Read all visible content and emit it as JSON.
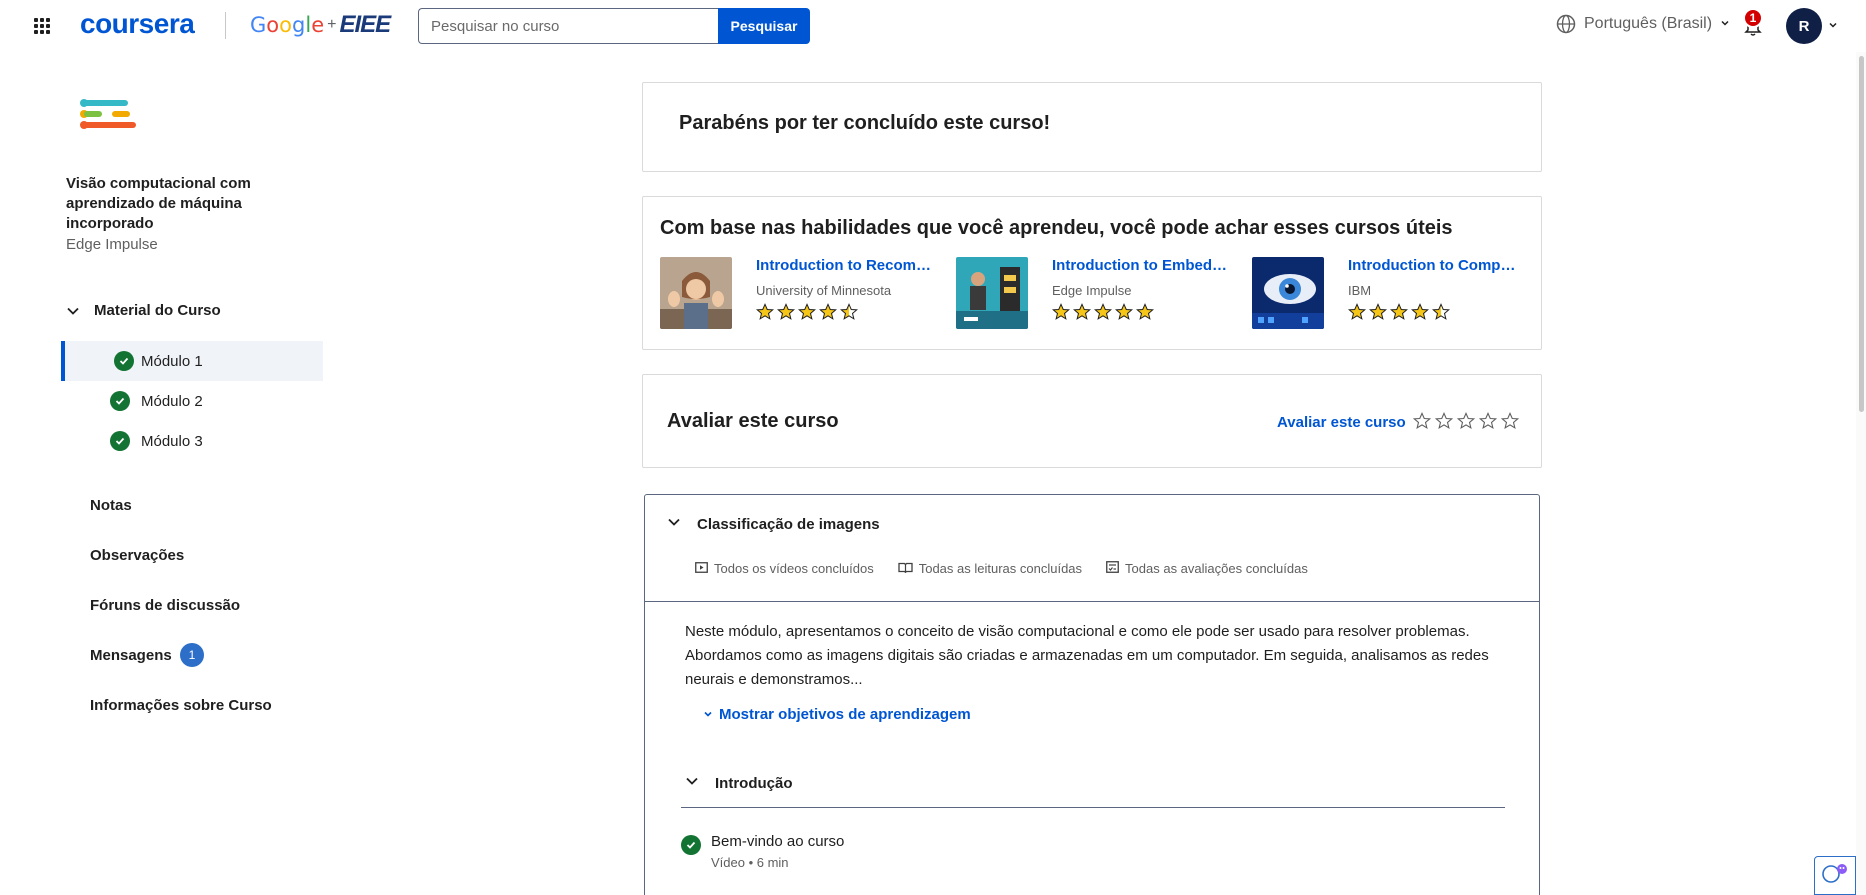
{
  "header": {
    "brand": "coursera",
    "partner_logo": {
      "google": "Google",
      "plus": "+",
      "eiee": "EIEE"
    },
    "search": {
      "placeholder": "Pesquisar no curso",
      "value": "",
      "button_label": "Pesquisar"
    },
    "language": "Português (Brasil)",
    "notifications_count": "1",
    "avatar_initial": "R",
    "icons": [
      "apps-grid-icon",
      "globe-icon",
      "chevron-down-icon",
      "bell-icon"
    ]
  },
  "sidebar": {
    "course_title": "Visão computacional com aprendizado de máquina incorporado",
    "provider": "Edge Impulse",
    "material_label": "Material do Curso",
    "modules": [
      {
        "label": "Módulo 1",
        "completed": true,
        "active": true
      },
      {
        "label": "Módulo 2",
        "completed": true,
        "active": false
      },
      {
        "label": "Módulo 3",
        "completed": true,
        "active": false
      }
    ],
    "links": [
      {
        "label": "Notas"
      },
      {
        "label": "Observações"
      },
      {
        "label": "Fóruns de discussão"
      },
      {
        "label": "Mensagens",
        "badge": "1"
      },
      {
        "label": "Informações sobre Curso"
      }
    ]
  },
  "main": {
    "congrats": "Parabéns por ter concluído este curso!",
    "recommendations": {
      "title": "Com base nas habilidades que você aprendeu, você pode achar esses cursos úteis",
      "items": [
        {
          "name": "Introduction to Recommender Systems",
          "partner": "University of Minnesota",
          "rating": 4.5
        },
        {
          "name": "Introduction to Embedded Machine Learning",
          "partner": "Edge Impulse",
          "rating": 5
        },
        {
          "name": "Introduction to Computer Vision",
          "partner": "IBM",
          "rating": 4.5
        }
      ]
    },
    "rate": {
      "title": "Avaliar este curso",
      "link": "Avaliar este curso",
      "stars": 0
    },
    "module": {
      "title": "Classificação de imagens",
      "stats": [
        "Todos os vídeos concluídos",
        "Todas as leituras concluídas",
        "Todas as avaliações concluídas"
      ],
      "description": "Neste módulo, apresentamos o conceito de visão computacional e como ele pode ser usado para resolver problemas. Abordamos como as imagens digitais são criadas e armazenadas em um computador. Em seguida, analisamos as redes neurais e demonstramos...",
      "show_objectives": "Mostrar objetivos de aprendizagem",
      "group": {
        "title": "Introdução",
        "items": [
          {
            "title": "Bem-vindo ao curso",
            "meta": "Vídeo • 6 min",
            "completed": true
          }
        ]
      }
    }
  },
  "colors": {
    "primary": "#0056d2",
    "success": "#137333",
    "badge_red": "#d30001",
    "star": "#f5c518"
  }
}
